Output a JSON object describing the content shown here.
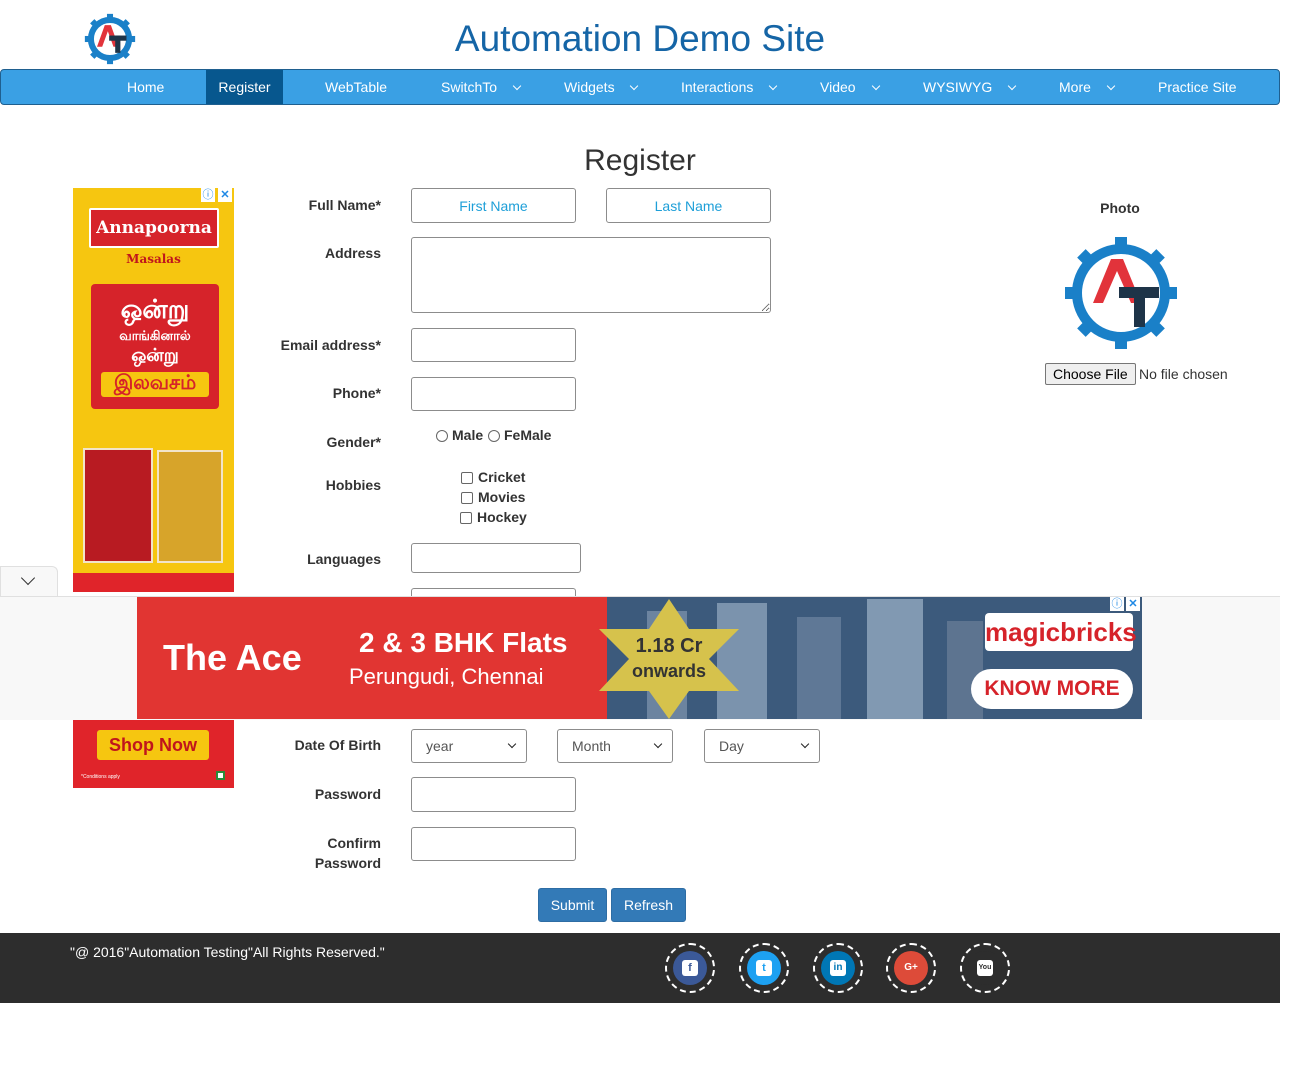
{
  "header": {
    "title": "Automation Demo Site"
  },
  "nav": {
    "items": [
      {
        "label": "Home"
      },
      {
        "label": "Register"
      },
      {
        "label": "WebTable"
      },
      {
        "label": "SwitchTo"
      },
      {
        "label": "Widgets"
      },
      {
        "label": "Interactions"
      },
      {
        "label": "Video"
      },
      {
        "label": "WYSIWYG"
      },
      {
        "label": "More"
      },
      {
        "label": "Practice Site"
      }
    ],
    "active": "Register",
    "colors": {
      "bar": "#3aa0e4",
      "active": "#07578e"
    }
  },
  "form": {
    "heading": "Register",
    "full_name_label": "Full Name*",
    "first_name_placeholder": "First Name",
    "last_name_placeholder": "Last Name",
    "address_label": "Address",
    "email_label": "Email address*",
    "phone_label": "Phone*",
    "gender_label": "Gender*",
    "gender_options": [
      "Male",
      "FeMale"
    ],
    "hobbies_label": "Hobbies",
    "hobbies": [
      "Cricket",
      "Movies",
      "Hockey"
    ],
    "languages_label": "Languages",
    "dob_label": "Date Of Birth",
    "dob_year": "year",
    "dob_month": "Month",
    "dob_day": "Day",
    "password_label": "Password",
    "confirm_password_label_1": "Confirm",
    "confirm_password_label_2": "Password",
    "submit_label": "Submit",
    "refresh_label": "Refresh"
  },
  "photo": {
    "label": "Photo",
    "choose_file_label": "Choose File",
    "no_file_text": "No file chosen"
  },
  "left_ad": {
    "brand": "Annapoorna",
    "sub": "Masalas",
    "line1": "ஒன்று",
    "line2": "வாங்கினால்",
    "line3": "ஒன்று",
    "line4": "இலவசம்",
    "cta": "Shop Now",
    "fine_print": "*Conditions apply"
  },
  "banner_ad": {
    "name": "The Ace",
    "headline": "2 & 3 BHK Flats",
    "location": "Perungudi, Chennai",
    "price_1": "1.18 Cr",
    "price_2": "onwards",
    "brand": "magicbricks",
    "cta": "KNOW MORE"
  },
  "footer": {
    "copyright": "\"@ 2016\"Automation Testing\"All Rights Reserved.\"",
    "social": [
      {
        "name": "facebook",
        "color": "#3b5998",
        "glyph": "f"
      },
      {
        "name": "twitter",
        "color": "#1da1f2",
        "glyph": "t"
      },
      {
        "name": "linkedin",
        "color": "#0077b5",
        "glyph": "in"
      },
      {
        "name": "google-plus",
        "color": "#dd4b39",
        "glyph": "G+"
      },
      {
        "name": "youtube",
        "color": "#2d2d2d",
        "glyph": "You"
      }
    ]
  }
}
